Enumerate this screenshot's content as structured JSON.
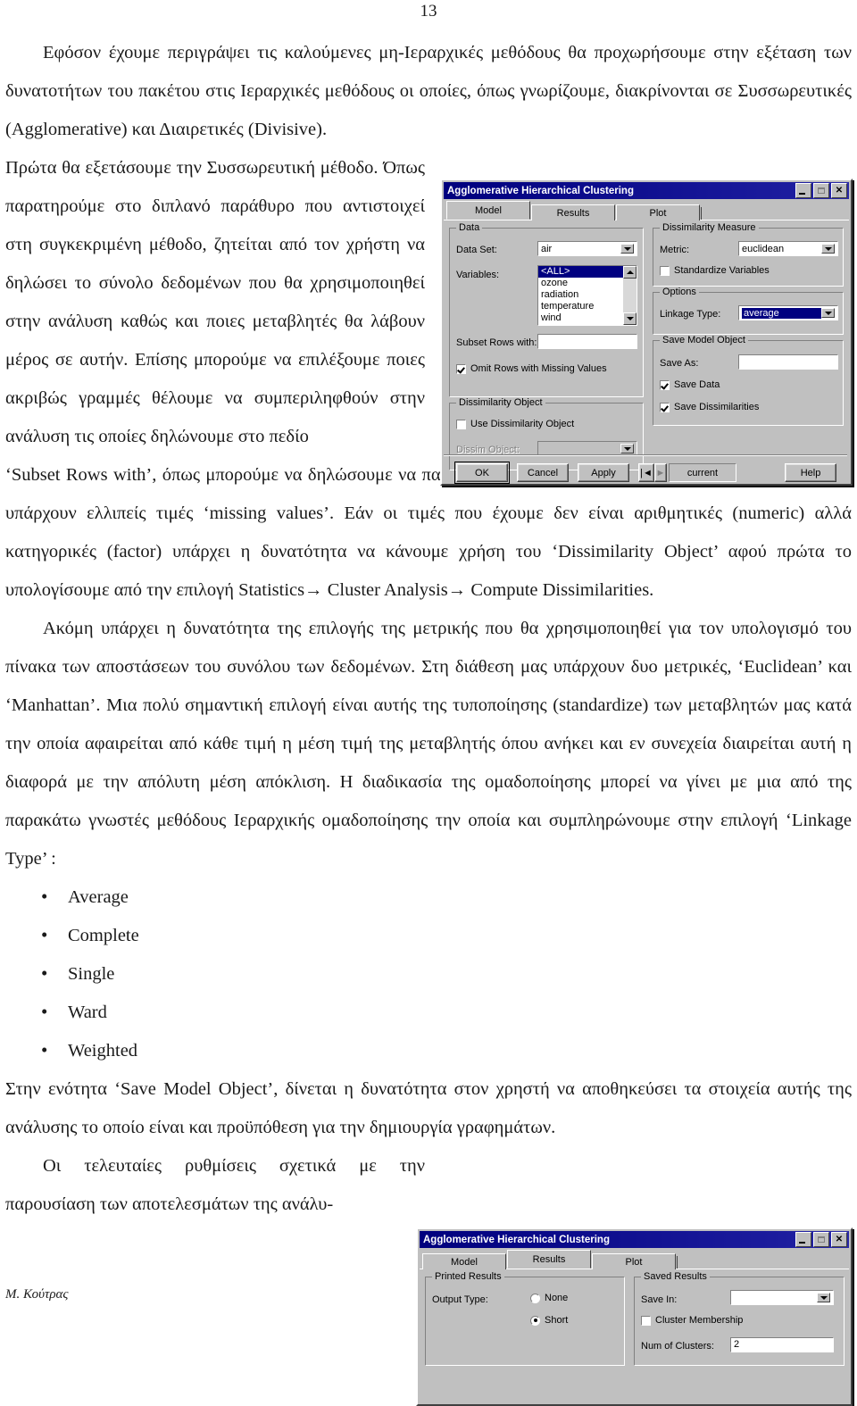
{
  "page": {
    "number": "13",
    "footer": "Μ. Κούτρας"
  },
  "paragraphs": {
    "p1": "Εφόσον έχουμε περιγράψει τις καλούμενες μη-Ιεραρχικές μεθόδους θα προχωρήσουμε στην εξέταση των δυνατοτήτων του πακέτου στις Ιεραρχικές μεθόδους οι οποίες, όπως γνωρίζουμε, διακρίνονται σε Συσσωρευτικές (Agglomerative) και Διαιρετικές (Divisive).",
    "p2": "Πρώτα θα εξετάσουμε την Συσσωρευτική μέθοδο. Όπως παρατηρούμε στο διπλανό παράθυρο που αντιστοιχεί στη συγκεκριμένη μέθοδο, ζητείται από τον χρήστη να δηλώσει το σύνολο δεδομένων που θα χρησιμοποιηθεί στην ανάλυση καθώς και ποιες μεταβλητές θα λάβουν μέρος σε αυτήν. Επίσης μπορούμε να επιλέξουμε ποιες ακριβώς γραμμές θέλουμε να συμπεριληφθούν στην ανάλυση τις οποίες δηλώνουμε στο πεδίο",
    "p3": "‘Subset Rows with’, όπως μπορούμε να δηλώσουμε να παραλειφθούν από την διαδικασία οι γραμμές στις οποίες υπάρχουν ελλιπείς τιμές ‘missing values’. Εάν οι τιμές που έχουμε δεν είναι αριθμητικές (numeric) αλλά κατηγορικές (factor)  υπάρχει η δυνατότητα να κάνουμε χρήση του ‘Dissimilarity Object’ αφού πρώτα το υπολογίσουμε από την επιλογή  Statistics→ Cluster Analysis→ Compute Dissimilarities.",
    "p4": "Ακόμη υπάρχει η δυνατότητα της επιλογής της μετρικής που θα χρησιμοποιηθεί για τον υπολογισμό του πίνακα των αποστάσεων του συνόλου των δεδομένων. Στη διάθεση μας υπάρχουν δυο μετρικές, ‘Euclidean’ και ‘Manhattan’. Μια πολύ σημαντική επιλογή είναι αυτής της τυποποίησης (standardize) των μεταβλητών μας κατά την οποία αφαιρείται από κάθε τιμή η μέση τιμή της μεταβλητής όπου ανήκει και εν συνεχεία διαιρείται αυτή η διαφορά με την απόλυτη μέση απόκλιση. Η διαδικασία της ομαδοποίησης μπορεί να γίνει με μια από της παρακάτω γνωστές μεθόδους Ιεραρχικής ομαδοποίησης την οποία και συμπληρώνουμε στην επιλογή ‘Linkage Type’ :",
    "p5": "Στην ενότητα ‘Save Model Object’, δίνεται η δυνατότητα στον χρηστή να αποθηκεύσει τα στοιχεία αυτής της ανάλυσης το οποίο είναι και προϋπόθεση για την δημιουργία γραφημάτων.",
    "p6": "Οι τελευταίες ρυθμίσεις σχετικά με την παρουσίαση των αποτελεσμάτων της ανάλυ-"
  },
  "linkage_types": [
    "Average",
    "Complete",
    "Single",
    "Ward",
    "Weighted"
  ],
  "dialog_model": {
    "title": "Agglomerative Hierarchical Clustering",
    "title_buttons": {
      "minimize": "_",
      "maximize": "□",
      "close": "✕"
    },
    "tabs": [
      {
        "label": "Model",
        "active": true
      },
      {
        "label": "Results",
        "active": false
      },
      {
        "label": "Plot",
        "active": false
      }
    ],
    "groups": {
      "data": {
        "legend": "Data",
        "data_set_label": "Data Set:",
        "data_set_value": "air",
        "variables_label": "Variables:",
        "variables_items": [
          "<ALL>",
          "ozone",
          "radiation",
          "temperature",
          "wind"
        ],
        "variables_selected": "<ALL>",
        "subset_rows_label": "Subset Rows with:",
        "subset_rows_value": "",
        "omit_rows_label": "Omit Rows with Missing Values",
        "omit_rows_checked": true
      },
      "dissimilarity_object": {
        "legend": "Dissimilarity Object",
        "use_dissim_label": "Use Dissimilarity Object",
        "use_dissim_checked": false,
        "dissim_object_label": "Dissim Object:",
        "dissim_object_value": ""
      },
      "dissimilarity_measure": {
        "legend": "Dissimilarity Measure",
        "metric_label": "Metric:",
        "metric_value": "euclidean",
        "standardize_label": "Standardize Variables",
        "standardize_checked": false
      },
      "options": {
        "legend": "Options",
        "linkage_label": "Linkage Type:",
        "linkage_value": "average"
      },
      "save_model_object": {
        "legend": "Save Model Object",
        "save_as_label": "Save As:",
        "save_as_value": "",
        "save_data_label": "Save Data",
        "save_data_checked": true,
        "save_dissim_label": "Save Dissimilarities",
        "save_dissim_checked": true
      }
    },
    "buttons": {
      "ok": "OK",
      "cancel": "Cancel",
      "apply": "Apply",
      "prev": "|◄",
      "next": "►",
      "current": "current",
      "help": "Help"
    }
  },
  "dialog_results": {
    "title": "Agglomerative Hierarchical Clustering",
    "title_buttons": {
      "minimize": "_",
      "maximize": "□",
      "close": "✕"
    },
    "tabs": [
      {
        "label": "Model",
        "active": false
      },
      {
        "label": "Results",
        "active": true
      },
      {
        "label": "Plot",
        "active": false
      }
    ],
    "groups": {
      "printed_results": {
        "legend": "Printed Results",
        "output_type_label": "Output Type:",
        "options": [
          {
            "label": "None",
            "checked": false
          },
          {
            "label": "Short",
            "checked": true
          }
        ]
      },
      "saved_results": {
        "legend": "Saved Results",
        "save_in_label": "Save In:",
        "save_in_value": "",
        "cluster_membership_label": "Cluster Membership",
        "cluster_membership_checked": false,
        "num_clusters_label": "Num of Clusters:",
        "num_clusters_value": "2"
      }
    }
  }
}
